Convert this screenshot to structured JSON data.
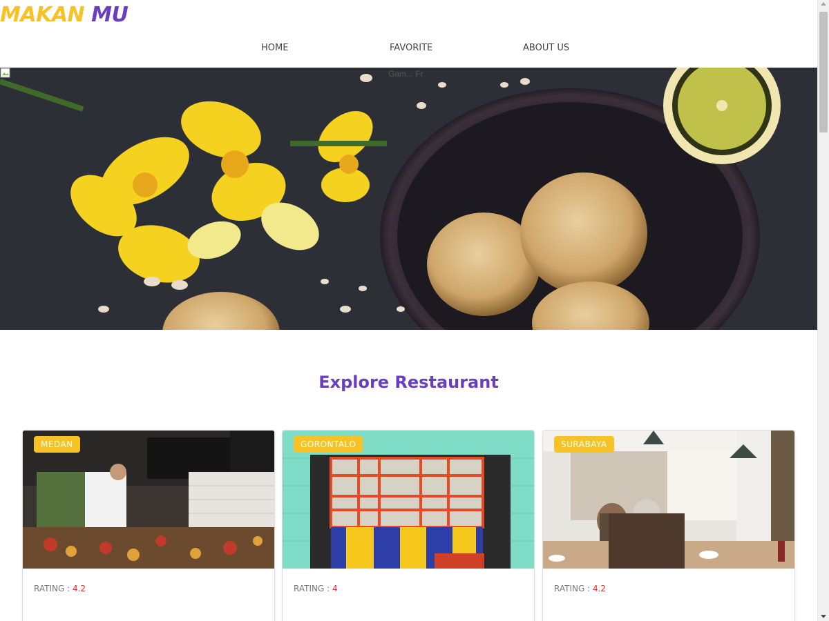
{
  "header": {
    "logo_part1": "MAKAN",
    "logo_part2": "MU",
    "nav": [
      "HOME",
      "FAVORITE",
      "ABOUT US"
    ]
  },
  "hero": {
    "alt_text": "Gam... Fr",
    "icon": "broken-image-icon"
  },
  "section": {
    "title": "Explore Restaurant"
  },
  "restaurants": [
    {
      "city": "MEDAN",
      "rating_label": "RATING :",
      "rating": "4.2"
    },
    {
      "city": "GORONTALO",
      "rating_label": "RATING :",
      "rating": "4"
    },
    {
      "city": "SURABAYA",
      "rating_label": "RATING :",
      "rating": "4.2"
    }
  ],
  "colors": {
    "brand_yellow": "#f6c226",
    "brand_purple": "#6a3fbf",
    "rating_red": "#e0302a"
  }
}
